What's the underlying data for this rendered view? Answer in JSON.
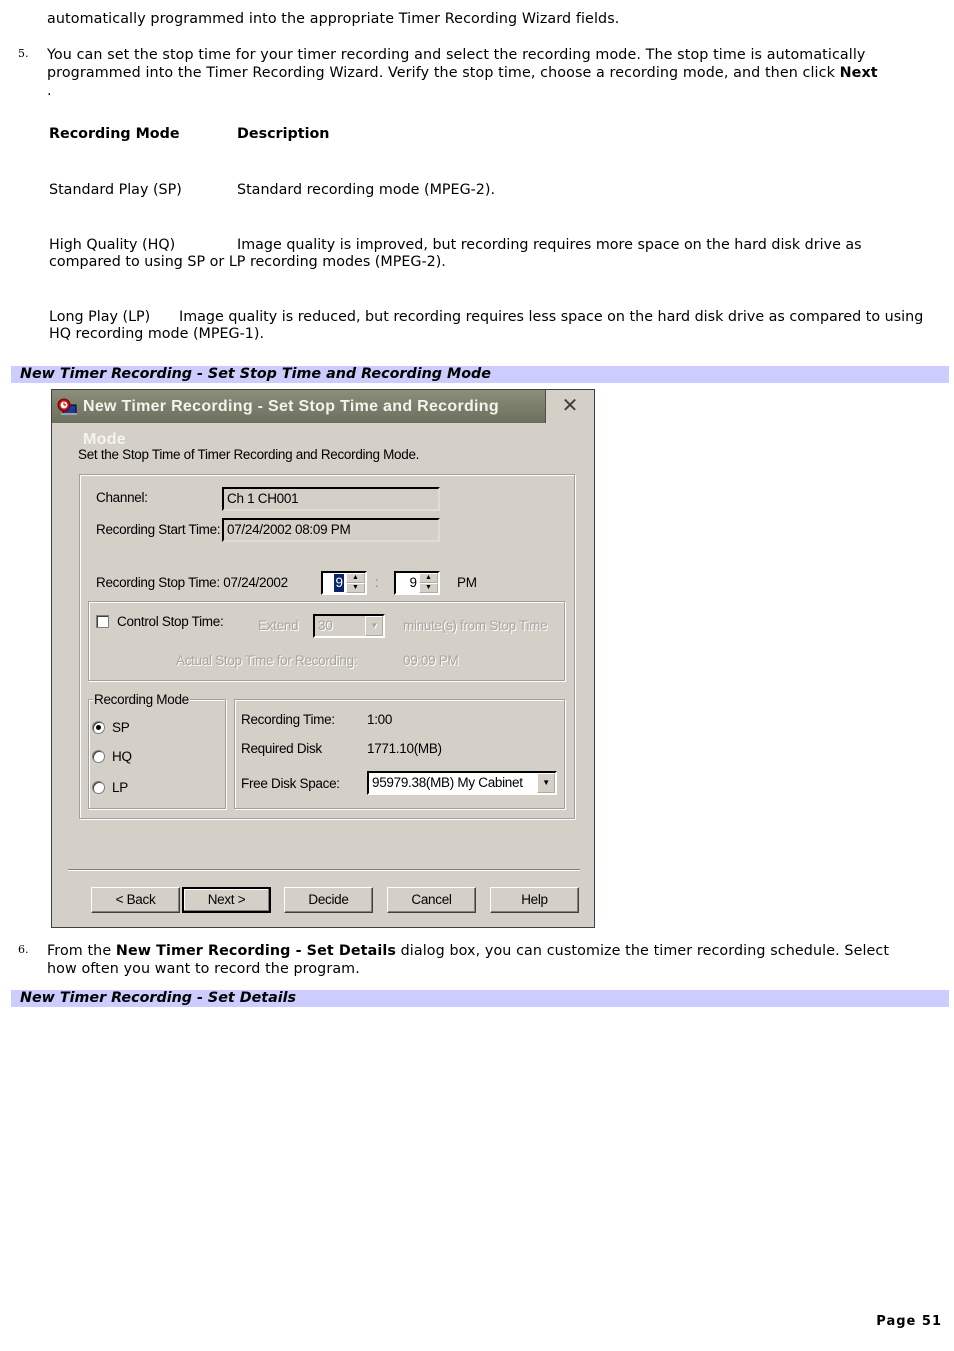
{
  "intro_continuation": "automatically programmed into the appropriate Timer Recording Wizard fields.",
  "step5": {
    "number": "5.",
    "text_before": "You can set the stop time for your timer recording and select the recording mode. The stop time is automatically programmed into the Timer Recording Wizard. Verify the stop time, choose a recording mode, and then click ",
    "bold": "Next",
    "text_after": "."
  },
  "modes_table": {
    "headers": [
      "Recording Mode",
      "Description"
    ],
    "rows": [
      {
        "mode": "Standard Play (SP)",
        "description": "Standard recording mode (MPEG-2)."
      },
      {
        "mode": "High Quality (HQ)",
        "description": "Image quality is improved, but recording requires more space on the hard disk drive as compared to using SP or LP recording modes (MPEG-2)."
      },
      {
        "mode": "Long Play (LP)",
        "description": "Image quality is reduced, but recording requires less space on the hard disk drive as compared to using HQ recording mode (MPEG-1)."
      }
    ]
  },
  "figure1_caption": "New Timer Recording - Set Stop Time and Recording Mode",
  "dialog": {
    "title": "New Timer Recording - Set Stop Time and Recording Mode",
    "close_glyph": "✕",
    "instruction": "Set the Stop Time of Timer Recording and Recording Mode.",
    "channel_label": "Channel:",
    "channel_value": "Ch 1 CH001",
    "start_label": "Recording Start Time:",
    "start_value": "07/24/2002 08:09 PM",
    "stop_label": "Recording Stop Time: 07/24/2002",
    "stop_hour": "9",
    "colon": ":",
    "stop_minute": "9",
    "ampm": "PM",
    "control_stop_label": "Control Stop Time:",
    "control_stop_checked": false,
    "extend_label": "Extend",
    "extend_value": "30",
    "extend_suffix": "minute(s) from Stop Time",
    "actual_stop_label": "Actual Stop Time for Recording:",
    "actual_stop_value": "09:09 PM",
    "mode_group_label": "Recording Mode",
    "modes": [
      "SP",
      "HQ",
      "LP"
    ],
    "selected_mode": "SP",
    "rec_time_label": "Recording Time:",
    "rec_time_value": "1:00",
    "req_disk_label": "Required Disk",
    "req_disk_value": "1771.10(MB)",
    "free_disk_label": "Free Disk Space:",
    "free_disk_value": "95979.38(MB) My Cabinet",
    "buttons": {
      "back": "< Back",
      "next": "Next >",
      "decide": "Decide",
      "cancel": "Cancel",
      "help": "Help"
    }
  },
  "step6": {
    "number": "6.",
    "text_before": "From the ",
    "bold": "New Timer Recording - Set Details",
    "text_after": " dialog box, you can customize the timer recording schedule. Select how often you want to record the program."
  },
  "figure2_caption": "New Timer Recording - Set Details",
  "page_label": "Page 51"
}
